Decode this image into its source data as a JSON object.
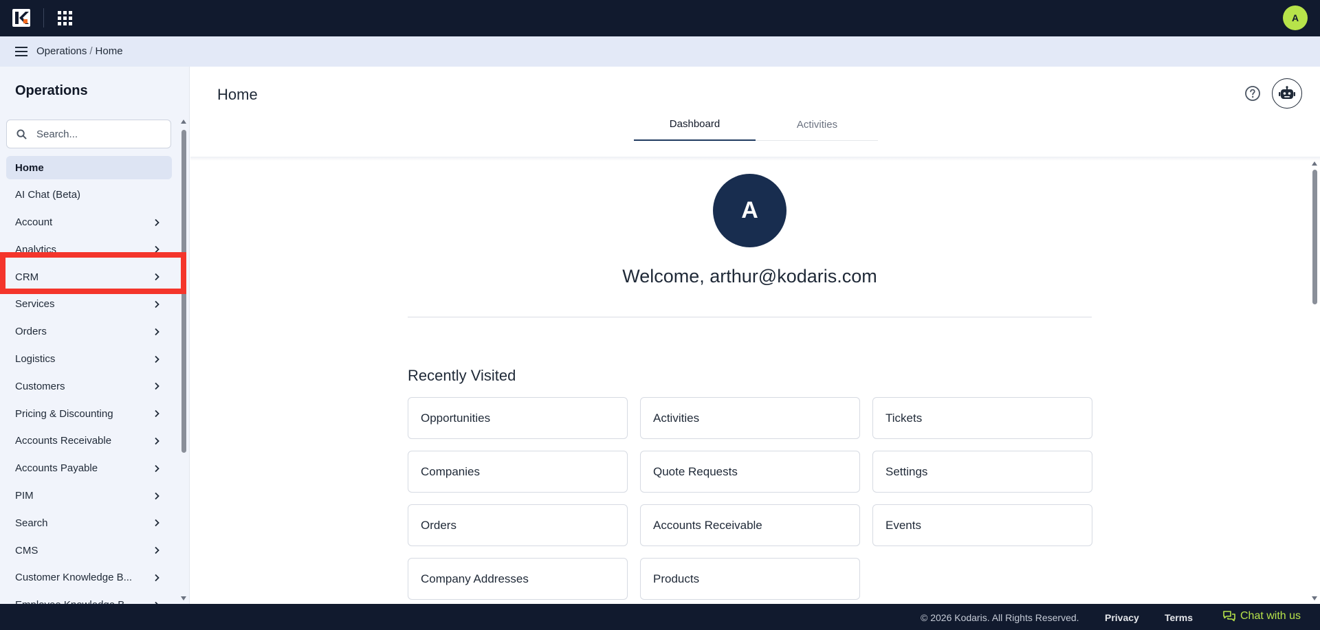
{
  "topbar": {
    "user_initial": "A"
  },
  "breadcrumb": {
    "section": "Operations",
    "separator": "/",
    "current": "Home"
  },
  "sidebar": {
    "title": "Operations",
    "search_placeholder": "Search...",
    "items": [
      {
        "label": "Home",
        "has_children": false,
        "active": true
      },
      {
        "label": "AI Chat (Beta)",
        "has_children": false
      },
      {
        "label": "Account",
        "has_children": true
      },
      {
        "label": "Analytics",
        "has_children": true
      },
      {
        "label": "CRM",
        "has_children": true
      },
      {
        "label": "Services",
        "has_children": true
      },
      {
        "label": "Orders",
        "has_children": true
      },
      {
        "label": "Logistics",
        "has_children": true
      },
      {
        "label": "Customers",
        "has_children": true
      },
      {
        "label": "Pricing & Discounting",
        "has_children": true
      },
      {
        "label": "Accounts Receivable",
        "has_children": true
      },
      {
        "label": "Accounts Payable",
        "has_children": true
      },
      {
        "label": "PIM",
        "has_children": true
      },
      {
        "label": "Search",
        "has_children": true
      },
      {
        "label": "CMS",
        "has_children": true
      },
      {
        "label": "Customer Knowledge B...",
        "has_children": true
      },
      {
        "label": "Employee Knowledge B...",
        "has_children": true
      }
    ]
  },
  "main": {
    "title": "Home",
    "tabs": [
      {
        "label": "Dashboard",
        "active": true
      },
      {
        "label": "Activities",
        "active": false
      }
    ],
    "avatar_initial": "A",
    "welcome": "Welcome, arthur@kodaris.com",
    "recently_visited_title": "Recently Visited",
    "recently_visited": [
      "Opportunities",
      "Activities",
      "Tickets",
      "Companies",
      "Quote Requests",
      "Settings",
      "Orders",
      "Accounts Receivable",
      "Events",
      "Company Addresses",
      "Products"
    ]
  },
  "footer": {
    "copyright": "© 2026 Kodaris. All Rights Reserved.",
    "privacy": "Privacy",
    "terms": "Terms",
    "chat": "Chat with us"
  },
  "colors": {
    "topbar": "#111a2e",
    "accent_lime": "#b7e34a",
    "annotation_red": "#f4352b",
    "avatar_navy": "#182d4f",
    "sidebar_bg": "#f1f4fb",
    "breadcrumb_bg": "#e3e9f7"
  },
  "icons": [
    "kodaris-logo",
    "apps-grid-icon",
    "menu-icon",
    "search-icon",
    "chevron-right-icon",
    "help-icon",
    "robot-icon",
    "chat-icon"
  ]
}
